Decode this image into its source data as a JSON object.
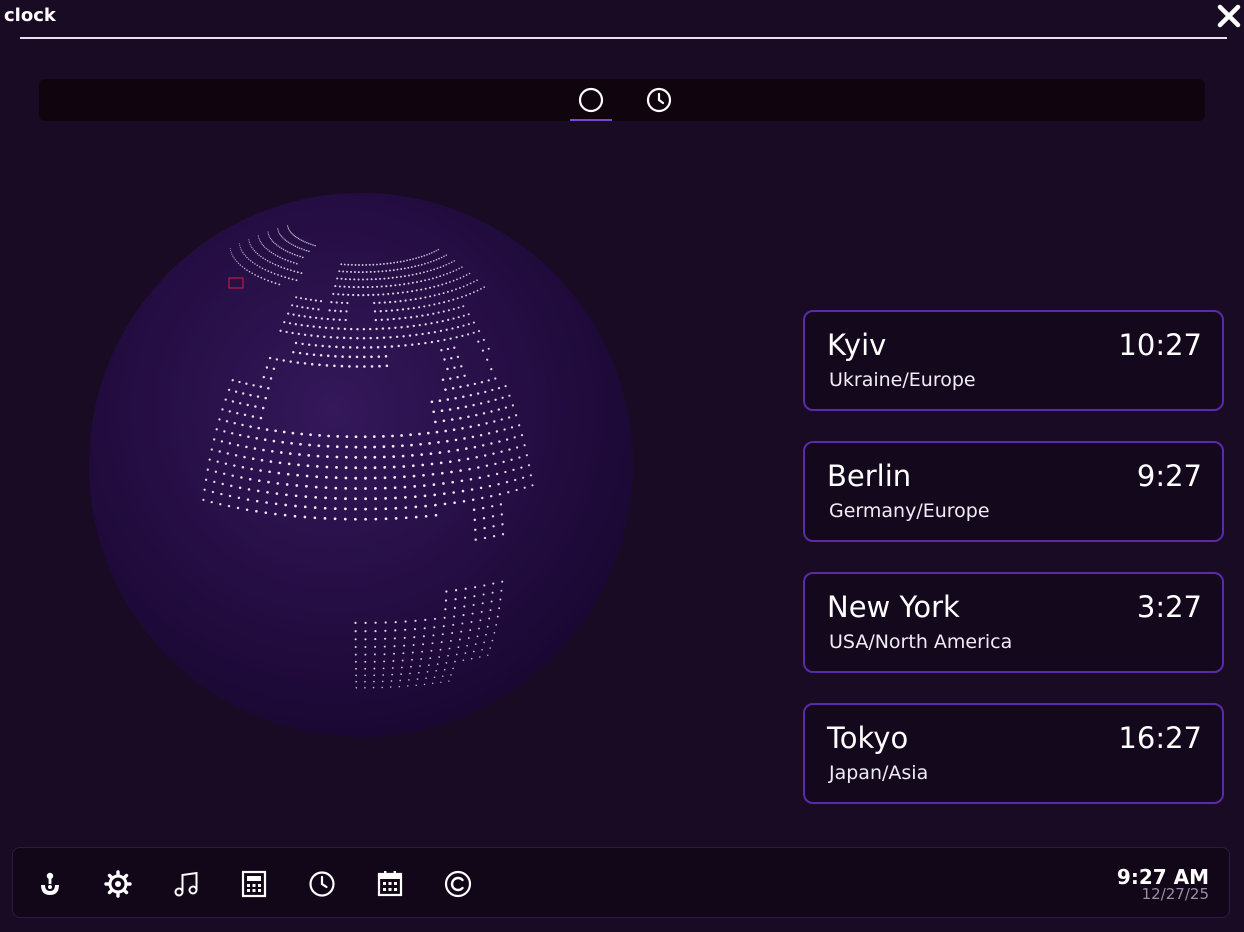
{
  "window": {
    "title": "clock",
    "close_icon": "close-icon"
  },
  "tabs": [
    {
      "icon": "globe-circle-icon",
      "active": true
    },
    {
      "icon": "clock-icon",
      "active": false
    }
  ],
  "globe": {
    "land_color": "#f2eef6",
    "sphere_color": "#2a1048",
    "marker_color": "#d81b45"
  },
  "clocks": [
    {
      "city": "Kyiv",
      "time": "10:27",
      "region": "Ukraine/Europe"
    },
    {
      "city": "Berlin",
      "time": "9:27",
      "region": "Germany/Europe"
    },
    {
      "city": "New York",
      "time": "3:27",
      "region": "USA/North America"
    },
    {
      "city": "Tokyo",
      "time": "16:27",
      "region": "Japan/Asia"
    }
  ],
  "taskbar": {
    "apps": [
      {
        "name": "joystick-icon"
      },
      {
        "name": "gear-icon"
      },
      {
        "name": "music-note-icon"
      },
      {
        "name": "calculator-icon"
      },
      {
        "name": "clock-icon"
      },
      {
        "name": "calendar-icon"
      },
      {
        "name": "copyright-icon"
      }
    ],
    "time": "9:27 AM",
    "date": "12/27/25"
  },
  "colors": {
    "background": "#1a0b24",
    "accent": "#7b45d8",
    "card_border": "#5a2aa8"
  }
}
